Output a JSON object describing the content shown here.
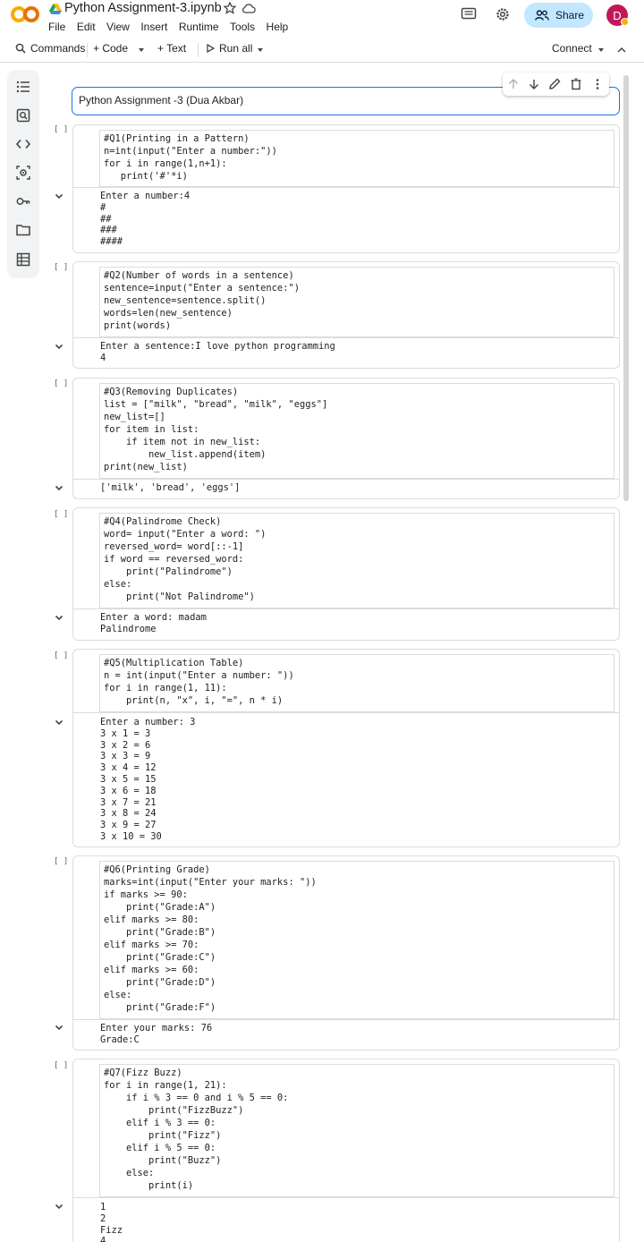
{
  "header": {
    "doc_title": "Python Assignment-3.ipynb",
    "menu": [
      "File",
      "Edit",
      "View",
      "Insert",
      "Runtime",
      "Tools",
      "Help"
    ],
    "share_label": "Share",
    "avatar_letter": "D"
  },
  "toolbar": {
    "commands_label": "Commands",
    "code_label": "+ Code",
    "text_label": "+ Text",
    "run_all_label": "Run all",
    "connect_label": "Connect"
  },
  "side_rail": {
    "icons": [
      "table-of-contents-icon",
      "find-icon",
      "code-snippets-icon",
      "variables-icon",
      "secrets-key-icon",
      "files-folder-icon",
      "terminal-table-icon"
    ]
  },
  "text_cell": {
    "content": "Python Assignment -3 (Dua Akbar)"
  },
  "cells": [
    {
      "run_marker": "[ ]",
      "code": "#Q1(Printing in a Pattern)\nn=int(input(\"Enter a number:\"))\nfor i in range(1,n+1):\n   print('#'*i)",
      "output": "Enter a number:4\n#\n##\n###\n####"
    },
    {
      "run_marker": "[ ]",
      "code": "#Q2(Number of words in a sentence)\nsentence=input(\"Enter a sentence:\")\nnew_sentence=sentence.split()\nwords=len(new_sentence)\nprint(words)",
      "output": "Enter a sentence:I love python programming\n4"
    },
    {
      "run_marker": "[ ]",
      "code": "#Q3(Removing Duplicates)\nlist = [\"milk\", \"bread\", \"milk\", \"eggs\"]\nnew_list=[]\nfor item in list:\n    if item not in new_list:\n        new_list.append(item)\nprint(new_list)",
      "output": "['milk', 'bread', 'eggs']"
    },
    {
      "run_marker": "[ ]",
      "code": "#Q4(Palindrome Check)\nword= input(\"Enter a word: \")\nreversed_word= word[::-1]\nif word == reversed_word:\n    print(\"Palindrome\")\nelse:\n    print(\"Not Palindrome\")",
      "output": "Enter a word: madam\nPalindrome"
    },
    {
      "run_marker": "[ ]",
      "code": "#Q5(Multiplication Table)\nn = int(input(\"Enter a number: \"))\nfor i in range(1, 11):\n    print(n, \"x\", i, \"=\", n * i)",
      "output": "Enter a number: 3\n3 x 1 = 3\n3 x 2 = 6\n3 x 3 = 9\n3 x 4 = 12\n3 x 5 = 15\n3 x 6 = 18\n3 x 7 = 21\n3 x 8 = 24\n3 x 9 = 27\n3 x 10 = 30"
    },
    {
      "run_marker": "[ ]",
      "code": "#Q6(Printing Grade)\nmarks=int(input(\"Enter your marks: \"))\nif marks >= 90:\n    print(\"Grade:A\")\nelif marks >= 80:\n    print(\"Grade:B\")\nelif marks >= 70:\n    print(\"Grade:C\")\nelif marks >= 60:\n    print(\"Grade:D\")\nelse:\n    print(\"Grade:F\")",
      "output": "Enter your marks: 76\nGrade:C"
    },
    {
      "run_marker": "[ ]",
      "code": "#Q7(Fizz Buzz)\nfor i in range(1, 21):\n    if i % 3 == 0 and i % 5 == 0:\n        print(\"FizzBuzz\")\n    elif i % 3 == 0:\n        print(\"Fizz\")\n    elif i % 5 == 0:\n        print(\"Buzz\")\n    else:\n        print(i)",
      "output": "1\n2\nFizz\n4"
    }
  ]
}
